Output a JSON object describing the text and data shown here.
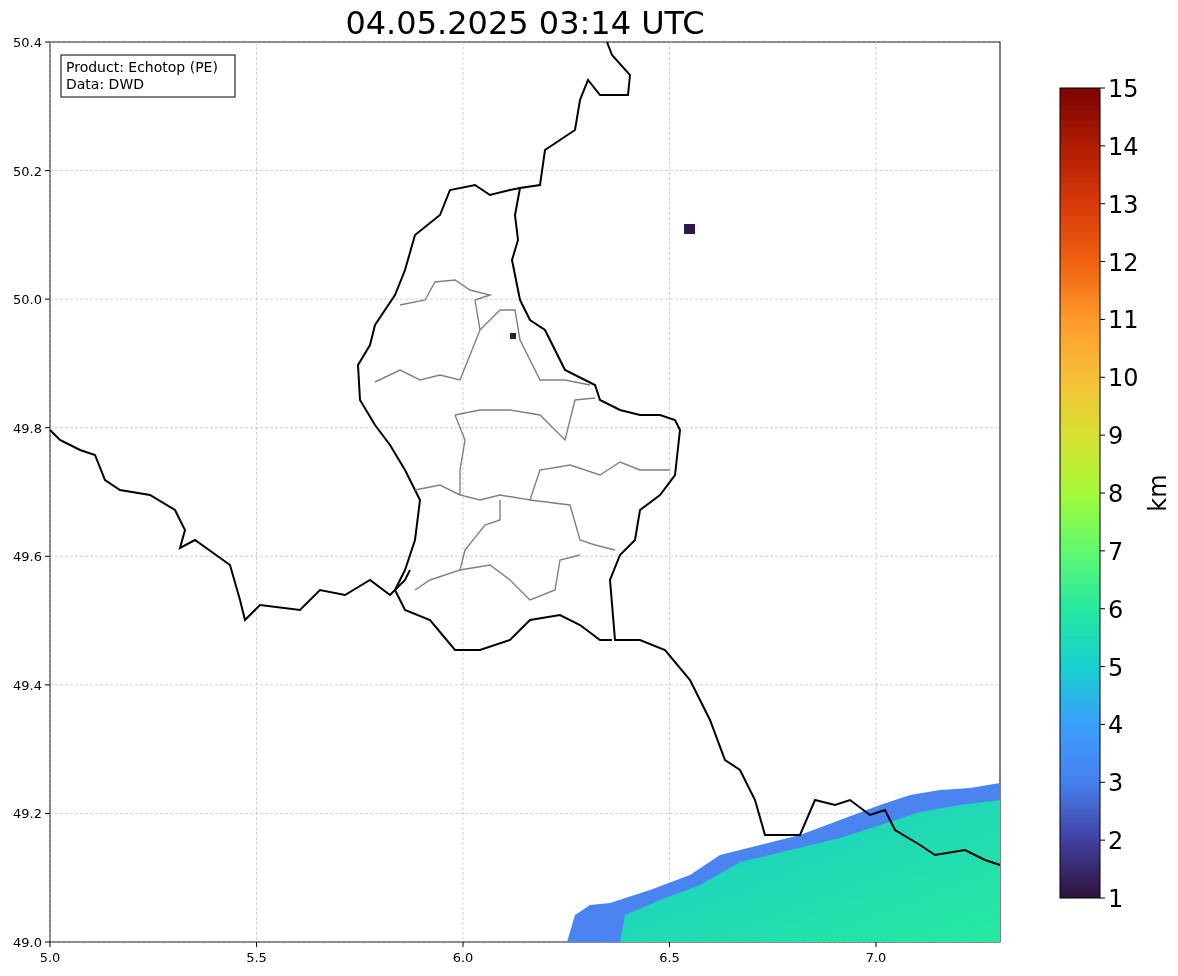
{
  "title": "04.05.2025 03:14 UTC",
  "info_box": {
    "lines": [
      "Product: Echotop (PE)",
      "Data: DWD"
    ]
  },
  "map": {
    "xticks": [
      "5.0",
      "5.5",
      "6.0",
      "6.5",
      "7.0"
    ],
    "yticks": [
      "50.4",
      "50.2",
      "50.0",
      "49.8",
      "49.6",
      "49.4",
      "49.2",
      "49.0"
    ]
  },
  "colorbar": {
    "ticks": [
      "15",
      "14",
      "13",
      "12",
      "11",
      "10",
      "9",
      "8",
      "7",
      "6",
      "5",
      "4",
      "3",
      "2",
      "1"
    ],
    "label": "km"
  }
}
